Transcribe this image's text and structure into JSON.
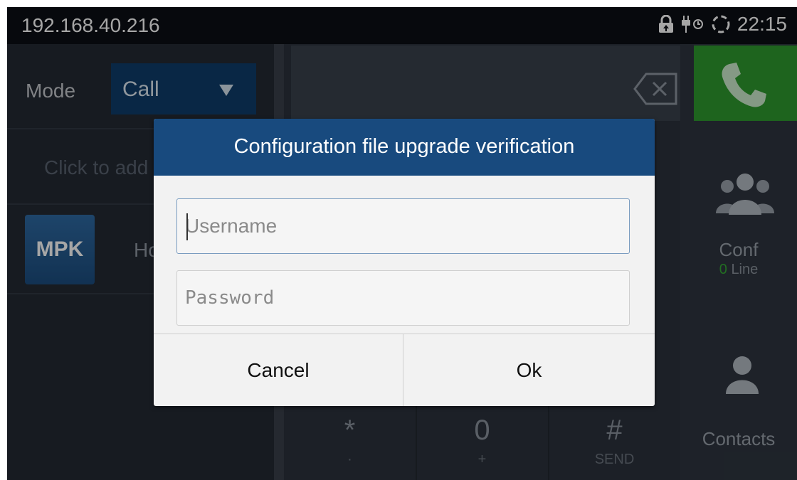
{
  "status_bar": {
    "ip": "192.168.40.216",
    "time": "22:15",
    "icons": [
      "lock-icon",
      "power-plug-icon",
      "sync-icon"
    ]
  },
  "left_panel": {
    "mode_label": "Mode",
    "mode_value": "Call",
    "click_to_add": "Click to add",
    "mpk_badge": "MPK",
    "mpk_name": "Ho"
  },
  "keypad": {
    "keys": [
      {
        "main": "*",
        "sub": "·"
      },
      {
        "main": "0",
        "sub": "+"
      },
      {
        "main": "#",
        "sub": "SEND"
      }
    ]
  },
  "right_panel": {
    "conf_label": "Conf",
    "conf_count": "0",
    "conf_unit": "Line",
    "contacts_label": "Contacts"
  },
  "dialog": {
    "title": "Configuration file upgrade verification",
    "username_placeholder": "Username",
    "password_placeholder": "Password",
    "cancel_label": "Cancel",
    "ok_label": "Ok"
  },
  "colors": {
    "dialog_header": "#184a7e",
    "call_button": "#2f9a2e",
    "conf_count": "#35a935"
  }
}
